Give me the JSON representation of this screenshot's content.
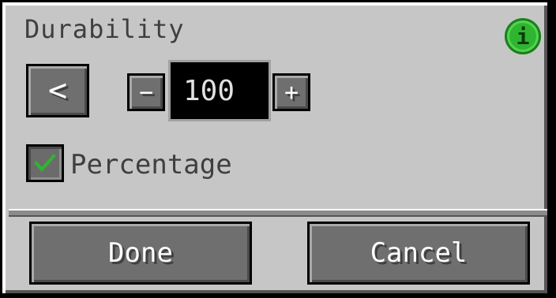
{
  "dialog": {
    "title": "Durability",
    "info_icon_glyph": "i",
    "back_glyph": "<",
    "stepper": {
      "minus_glyph": "−",
      "plus_glyph": "+",
      "value": "100"
    },
    "percentage": {
      "label": "Percentage",
      "checked": true
    },
    "buttons": {
      "done": "Done",
      "cancel": "Cancel"
    }
  },
  "colors": {
    "panel": "#c6c6c6",
    "button": "#6f6f6f",
    "info": "#2fb52f",
    "check": "#2fb52f"
  },
  "icons": [
    "info-icon",
    "chevron-left-icon",
    "minus-icon",
    "plus-icon",
    "check-icon"
  ]
}
